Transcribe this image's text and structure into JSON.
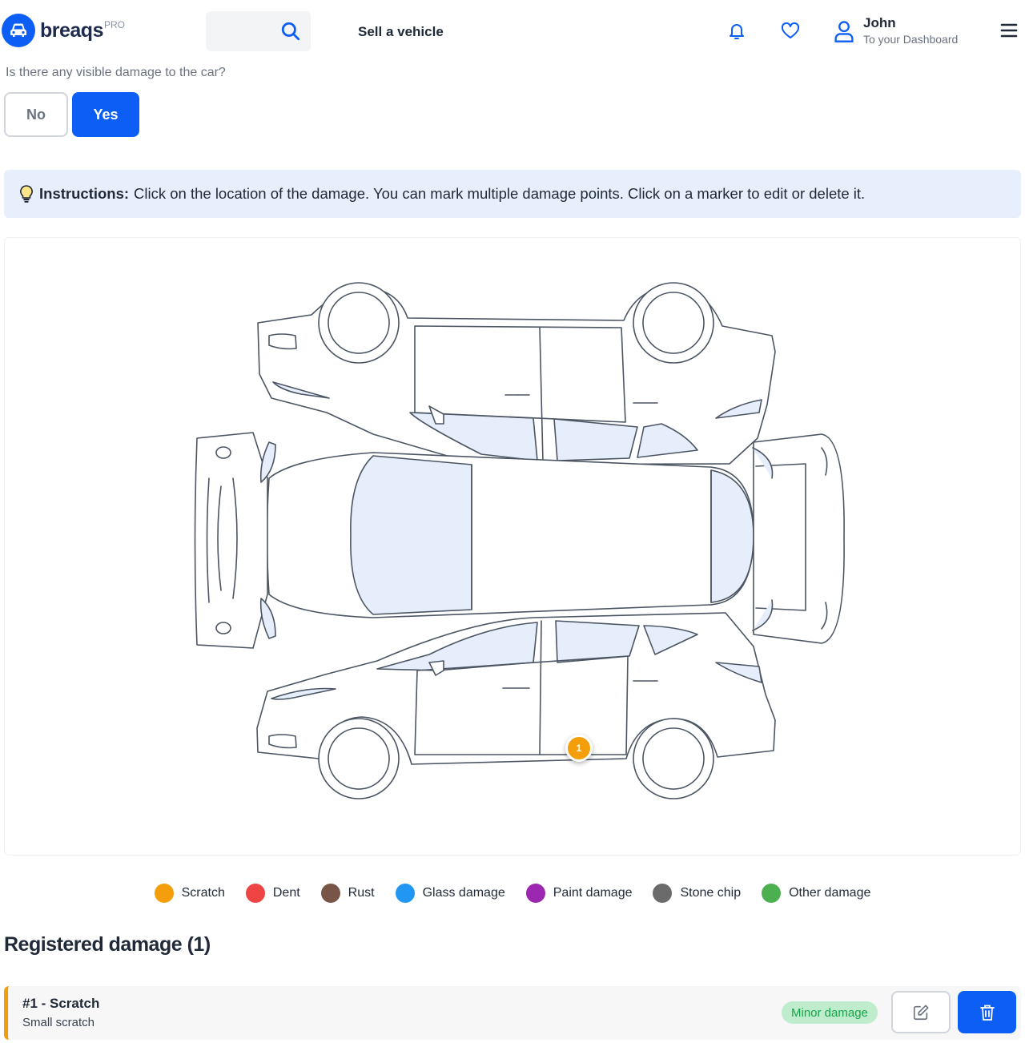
{
  "header": {
    "logo_text": "breaqs",
    "logo_badge": "PRO",
    "sell_label": "Sell a vehicle",
    "user_name": "John",
    "user_sub": "To your Dashboard",
    "icons": [
      "car-icon",
      "search-icon",
      "bell-icon",
      "heart-icon",
      "user-icon",
      "menu-icon"
    ]
  },
  "question": {
    "text": "Is there any visible damage to the car?",
    "no_label": "No",
    "yes_label": "Yes",
    "selected": "Yes"
  },
  "instructions": {
    "label": "Instructions:",
    "text": "Click on the location of the damage. You can mark multiple damage points. Click on a marker to edit or delete it."
  },
  "diagram": {
    "marker": {
      "number": "1",
      "type": "Scratch",
      "color": "#f59e0b"
    }
  },
  "legend": [
    {
      "label": "Scratch",
      "color": "#f59e0b"
    },
    {
      "label": "Dent",
      "color": "#ef4444"
    },
    {
      "label": "Rust",
      "color": "#795548"
    },
    {
      "label": "Glass damage",
      "color": "#2196f3"
    },
    {
      "label": "Paint damage",
      "color": "#9c27b0"
    },
    {
      "label": "Stone chip",
      "color": "#6b6b6b"
    },
    {
      "label": "Other damage",
      "color": "#4caf50"
    }
  ],
  "registered": {
    "title": "Registered damage (1)",
    "items": [
      {
        "title": "#1 - Scratch",
        "description": "Small scratch",
        "severity": "Minor damage",
        "color": "#f59e0b"
      }
    ]
  },
  "colors": {
    "primary": "#0d5ef4",
    "instructions_bg": "#e8effc",
    "glass": "#e6eefb",
    "outline": "#4b5563"
  }
}
